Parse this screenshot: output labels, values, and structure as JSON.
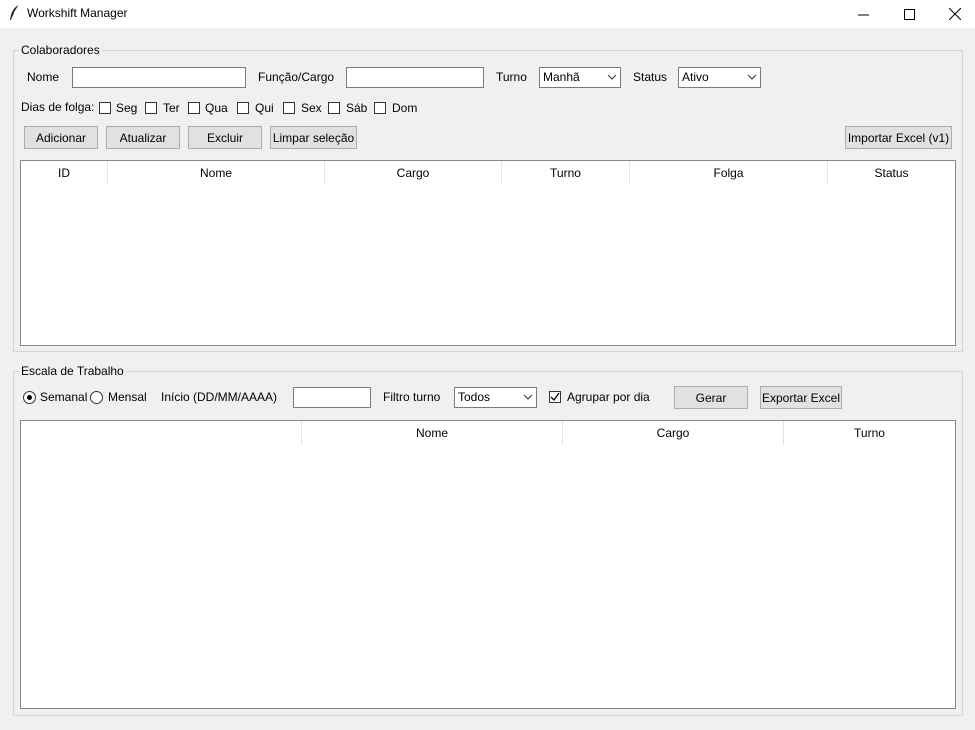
{
  "window": {
    "title": "Workshift Manager"
  },
  "colaboradores": {
    "group_title": "Colaboradores",
    "nome_label": "Nome",
    "nome_value": "",
    "funcao_label": "Função/Cargo",
    "funcao_value": "",
    "turno_label": "Turno",
    "turno_value": "Manhã",
    "status_label": "Status",
    "status_value": "Ativo",
    "dias_label": "Dias de folga:",
    "dias": [
      {
        "label": "Seg",
        "checked": false
      },
      {
        "label": "Ter",
        "checked": false
      },
      {
        "label": "Qua",
        "checked": false
      },
      {
        "label": "Qui",
        "checked": false
      },
      {
        "label": "Sex",
        "checked": false
      },
      {
        "label": "Sáb",
        "checked": false
      },
      {
        "label": "Dom",
        "checked": false
      }
    ],
    "buttons": {
      "adicionar": "Adicionar",
      "atualizar": "Atualizar",
      "excluir": "Excluir",
      "limpar": "Limpar seleção",
      "importar": "Importar Excel (v1)"
    },
    "columns": [
      "ID",
      "Nome",
      "Cargo",
      "Turno",
      "Folga",
      "Status"
    ]
  },
  "escala": {
    "group_title": "Escala de Trabalho",
    "semanal_label": "Semanal",
    "semanal_selected": true,
    "mensal_label": "Mensal",
    "inicio_label": "Início (DD/MM/AAAA)",
    "inicio_value": "",
    "filtro_label": "Filtro turno",
    "filtro_value": "Todos",
    "agrupar_label": "Agrupar por dia",
    "agrupar_checked": true,
    "gerar_label": "Gerar",
    "exportar_label": "Exportar Excel",
    "columns": [
      "",
      "Nome",
      "Cargo",
      "Turno"
    ]
  }
}
